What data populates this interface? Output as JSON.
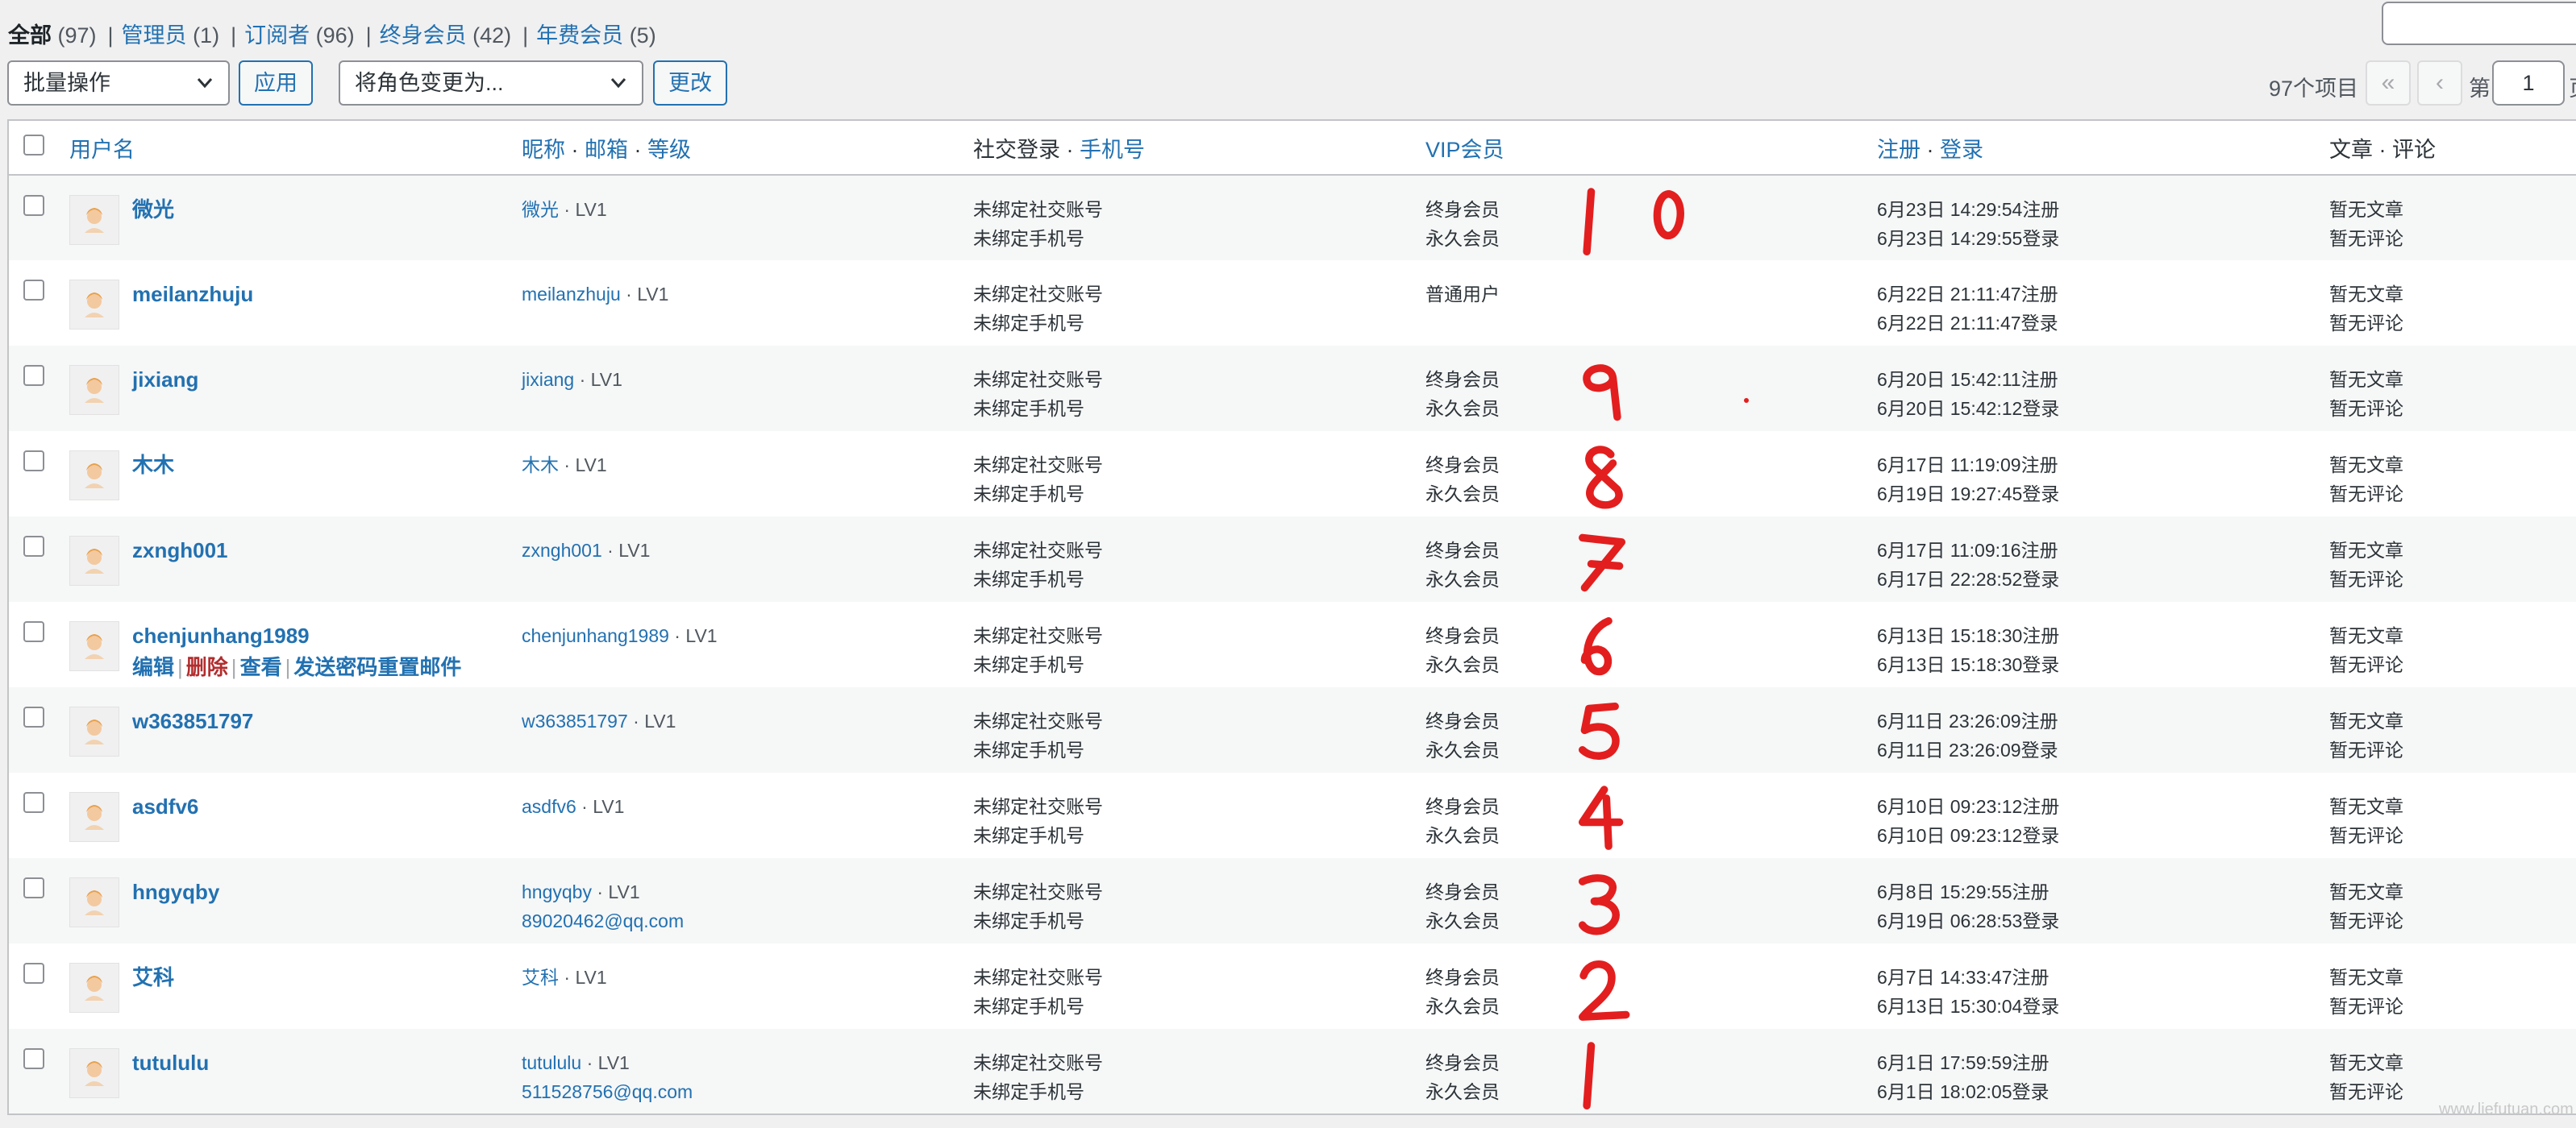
{
  "filters": [
    {
      "label": "全部",
      "count": "(97)",
      "current": true
    },
    {
      "label": "管理员",
      "count": "(1)",
      "current": false
    },
    {
      "label": "订阅者",
      "count": "(96)",
      "current": false
    },
    {
      "label": "终身会员",
      "count": "(42)",
      "current": false
    },
    {
      "label": "年费会员",
      "count": "(5)",
      "current": false
    }
  ],
  "toolbar": {
    "bulk_select": "批量操作",
    "apply": "应用",
    "role_select": "将角色变更为...",
    "change": "更改"
  },
  "pagination": {
    "items": "97个项目",
    "first": "«",
    "prev": "‹",
    "label": "第",
    "page": "1",
    "tail": "页"
  },
  "columns": {
    "username": "用户名",
    "nick": "昵称",
    "email": "邮箱",
    "level": "等级",
    "social": "社交登录",
    "phone": "手机号",
    "vip": "VIP会员",
    "reg": "注册",
    "login": "登录",
    "posts": "文章",
    "comments": "评论"
  },
  "row_actions": {
    "edit": "编辑",
    "delete": "删除",
    "view": "查看",
    "reset": "发送密码重置邮件"
  },
  "users": [
    {
      "username": "微光",
      "nick": "微光",
      "level": "LV1",
      "email": "",
      "social": "未绑定社交账号",
      "phone": "未绑定手机号",
      "vip1": "终身会员",
      "vip2": "永久会员",
      "reg": "6月23日 14:29:54注册",
      "login": "6月23日 14:29:55登录",
      "posts": "暂无文章",
      "comments": "暂无评论",
      "annotation": "10"
    },
    {
      "username": "meilanzhuju",
      "nick": "meilanzhuju",
      "level": "LV1",
      "email": "",
      "social": "未绑定社交账号",
      "phone": "未绑定手机号",
      "vip1": "普通用户",
      "vip2": "",
      "reg": "6月22日 21:11:47注册",
      "login": "6月22日 21:11:47登录",
      "posts": "暂无文章",
      "comments": "暂无评论",
      "annotation": ""
    },
    {
      "username": "jixiang",
      "nick": "jixiang",
      "level": "LV1",
      "email": "",
      "social": "未绑定社交账号",
      "phone": "未绑定手机号",
      "vip1": "终身会员",
      "vip2": "永久会员",
      "reg": "6月20日 15:42:11注册",
      "login": "6月20日 15:42:12登录",
      "posts": "暂无文章",
      "comments": "暂无评论",
      "annotation": "9"
    },
    {
      "username": "木木",
      "nick": "木木",
      "level": "LV1",
      "email": "",
      "social": "未绑定社交账号",
      "phone": "未绑定手机号",
      "vip1": "终身会员",
      "vip2": "永久会员",
      "reg": "6月17日 11:19:09注册",
      "login": "6月19日 19:27:45登录",
      "posts": "暂无文章",
      "comments": "暂无评论",
      "annotation": "8"
    },
    {
      "username": "zxngh001",
      "nick": "zxngh001",
      "level": "LV1",
      "email": "",
      "social": "未绑定社交账号",
      "phone": "未绑定手机号",
      "vip1": "终身会员",
      "vip2": "永久会员",
      "reg": "6月17日 11:09:16注册",
      "login": "6月17日 22:28:52登录",
      "posts": "暂无文章",
      "comments": "暂无评论",
      "annotation": "7"
    },
    {
      "username": "chenjunhang1989",
      "nick": "chenjunhang1989",
      "level": "LV1",
      "email": "",
      "social": "未绑定社交账号",
      "phone": "未绑定手机号",
      "vip1": "终身会员",
      "vip2": "永久会员",
      "reg": "6月13日 15:18:30注册",
      "login": "6月13日 15:18:30登录",
      "posts": "暂无文章",
      "comments": "暂无评论",
      "annotation": "6"
    },
    {
      "username": "w363851797",
      "nick": "w363851797",
      "level": "LV1",
      "email": "",
      "social": "未绑定社交账号",
      "phone": "未绑定手机号",
      "vip1": "终身会员",
      "vip2": "永久会员",
      "reg": "6月11日 23:26:09注册",
      "login": "6月11日 23:26:09登录",
      "posts": "暂无文章",
      "comments": "暂无评论",
      "annotation": "5"
    },
    {
      "username": "asdfv6",
      "nick": "asdfv6",
      "level": "LV1",
      "email": "",
      "social": "未绑定社交账号",
      "phone": "未绑定手机号",
      "vip1": "终身会员",
      "vip2": "永久会员",
      "reg": "6月10日 09:23:12注册",
      "login": "6月10日 09:23:12登录",
      "posts": "暂无文章",
      "comments": "暂无评论",
      "annotation": "4"
    },
    {
      "username": "hngyqby",
      "nick": "hngyqby",
      "level": "LV1",
      "email": "89020462@qq.com",
      "social": "未绑定社交账号",
      "phone": "未绑定手机号",
      "vip1": "终身会员",
      "vip2": "永久会员",
      "reg": "6月8日 15:29:55注册",
      "login": "6月19日 06:28:53登录",
      "posts": "暂无文章",
      "comments": "暂无评论",
      "annotation": "3"
    },
    {
      "username": "艾科",
      "nick": "艾科",
      "level": "LV1",
      "email": "",
      "social": "未绑定社交账号",
      "phone": "未绑定手机号",
      "vip1": "终身会员",
      "vip2": "永久会员",
      "reg": "6月7日 14:33:47注册",
      "login": "6月13日 15:30:04登录",
      "posts": "暂无文章",
      "comments": "暂无评论",
      "annotation": "2"
    },
    {
      "username": "tutululu",
      "nick": "tutululu",
      "level": "LV1",
      "email": "511528756@qq.com",
      "social": "未绑定社交账号",
      "phone": "未绑定手机号",
      "vip1": "终身会员",
      "vip2": "永久会员",
      "reg": "6月1日 17:59:59注册",
      "login": "6月1日 18:02:05登录",
      "posts": "暂无文章",
      "comments": "暂无评论",
      "annotation": "1"
    }
  ],
  "watermark": "www.liefutuan.com",
  "colors": {
    "link": "#2271b1",
    "annotation": "#e31e1e",
    "delete": "#b32d2e"
  }
}
